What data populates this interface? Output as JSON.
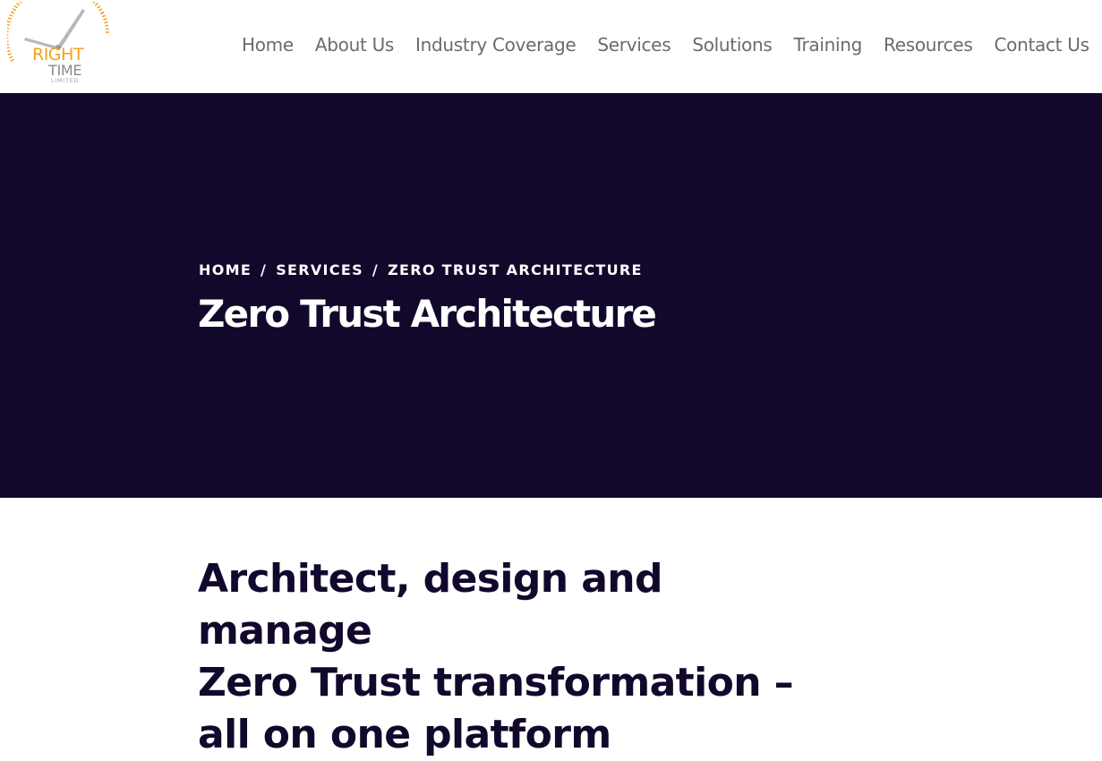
{
  "logo": {
    "word1": "RIGHT",
    "word2": "TIME",
    "word3": "LIMITED",
    "colors": {
      "orange": "#f2a21c",
      "gray": "#8a8a8a"
    }
  },
  "nav": {
    "items": [
      {
        "label": "Home"
      },
      {
        "label": "About Us"
      },
      {
        "label": "Industry Coverage"
      },
      {
        "label": "Services"
      },
      {
        "label": "Solutions"
      },
      {
        "label": "Training"
      },
      {
        "label": "Resources"
      },
      {
        "label": "Contact Us"
      }
    ]
  },
  "breadcrumb": {
    "home": "HOME",
    "services": "SERVICES",
    "current": "ZERO TRUST ARCHITECTURE",
    "separator": "/"
  },
  "hero": {
    "title": "Zero Trust Architecture",
    "background": "#12082c"
  },
  "main": {
    "heading_line1": "Architect, design and manage",
    "heading_line2": "Zero Trust transformation –",
    "heading_line3": "all on one platform"
  }
}
